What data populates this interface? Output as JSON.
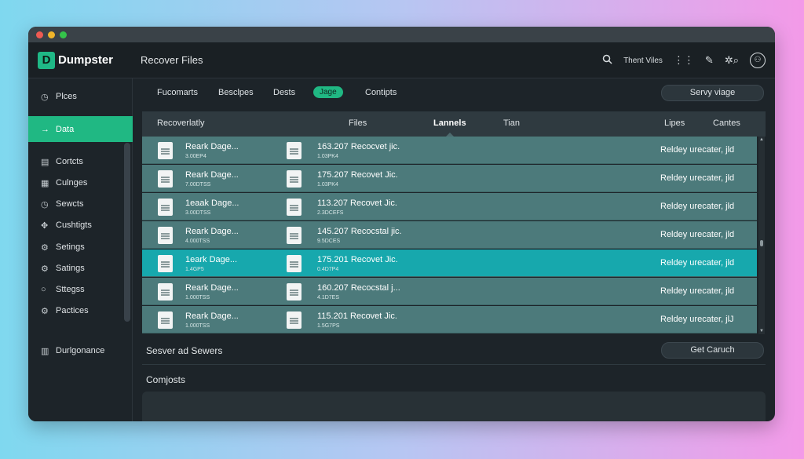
{
  "app": {
    "logo_letter": "D",
    "name": "Dumpster",
    "title": "Recover Files"
  },
  "header": {
    "search_icon": "search-icon",
    "user_text": "Thent Viles",
    "icons": [
      "sliders-icon",
      "feather-icon",
      "settings-search-icon",
      "user-circle-icon"
    ]
  },
  "sidebar": {
    "items": [
      {
        "label": "Plces",
        "icon": "clock-icon",
        "active": false
      },
      {
        "label": "Data",
        "icon": "arrow-icon",
        "active": true
      },
      {
        "label": "Cortcts",
        "icon": "contacts-icon",
        "active": false
      },
      {
        "label": "Culnges",
        "icon": "calendar-icon",
        "active": false
      },
      {
        "label": "Sewcts",
        "icon": "clock-icon",
        "active": false
      },
      {
        "label": "Cushtigts",
        "icon": "puzzle-icon",
        "active": false
      },
      {
        "label": "Setings",
        "icon": "gear-icon",
        "active": false
      },
      {
        "label": "Satings",
        "icon": "gear-icon",
        "active": false
      },
      {
        "label": "Sttegss",
        "icon": "circle-icon",
        "active": false
      },
      {
        "label": "Pactices",
        "icon": "gear-icon",
        "active": false
      }
    ],
    "bottom_item": {
      "label": "Durlgonance",
      "icon": "building-icon"
    }
  },
  "tabs": [
    {
      "label": "Fucomarts",
      "active": false
    },
    {
      "label": "Besclpes",
      "active": false
    },
    {
      "label": "Dests",
      "active": false
    },
    {
      "label": "Jage",
      "active": true
    },
    {
      "label": "Contipts",
      "active": false
    }
  ],
  "save_button": "Servy viage",
  "table": {
    "headers": [
      "Recoverlatly",
      "Files",
      "Lannels",
      "Tian",
      "Lipes",
      "Cantes"
    ],
    "active_header": "Lannels",
    "rows": [
      {
        "name": "Reark Dage...",
        "size": "3.00EP4",
        "file": "163.207 Recocvet jic.",
        "file_sub": "1.03PK4",
        "status": "Reldey urecater, jld",
        "selected": false
      },
      {
        "name": "Reark Dage...",
        "size": "7.00DTSS",
        "file": "175.207 Recovet Jic.",
        "file_sub": "1.03PK4",
        "status": "Reldey urecater, jld",
        "selected": false
      },
      {
        "name": "1eaak Dage...",
        "size": "3.00DTSS",
        "file": "113.207 Recovet Jic.",
        "file_sub": "2.3DCEFS",
        "status": "Reldey urecater, jld",
        "selected": false
      },
      {
        "name": "Reark Dage...",
        "size": "4.000TSS",
        "file": "145.207 Recocstal jic.",
        "file_sub": "9.5DCES",
        "status": "Reldey urecater, jld",
        "selected": false
      },
      {
        "name": "1eark Dage...",
        "size": "1.4GP5",
        "file": "175.201 Recovet Jic.",
        "file_sub": "0.4D7P4",
        "status": "Reldey urecater, jld",
        "selected": true
      },
      {
        "name": "Reark Dage...",
        "size": "1.000TSS",
        "file": "160.207 Recocstal j...",
        "file_sub": "4.1D7ES",
        "status": "Reldey urecater, jld",
        "selected": false
      },
      {
        "name": "Reark Dage...",
        "size": "1.000TSS",
        "file": "115.201 Recovet Jic.",
        "file_sub": "1.5G7PS",
        "status": "Reldey urecater, jlJ",
        "selected": false
      }
    ]
  },
  "servers_label": "Sesver ad Sewers",
  "get_crunch_button": "Get Caruch",
  "comments_label": "Comjosts",
  "colors": {
    "accent": "#20b883",
    "row_bg": "#4c7a7b",
    "row_selected": "#17a8ad",
    "window_bg": "#1d2429"
  }
}
